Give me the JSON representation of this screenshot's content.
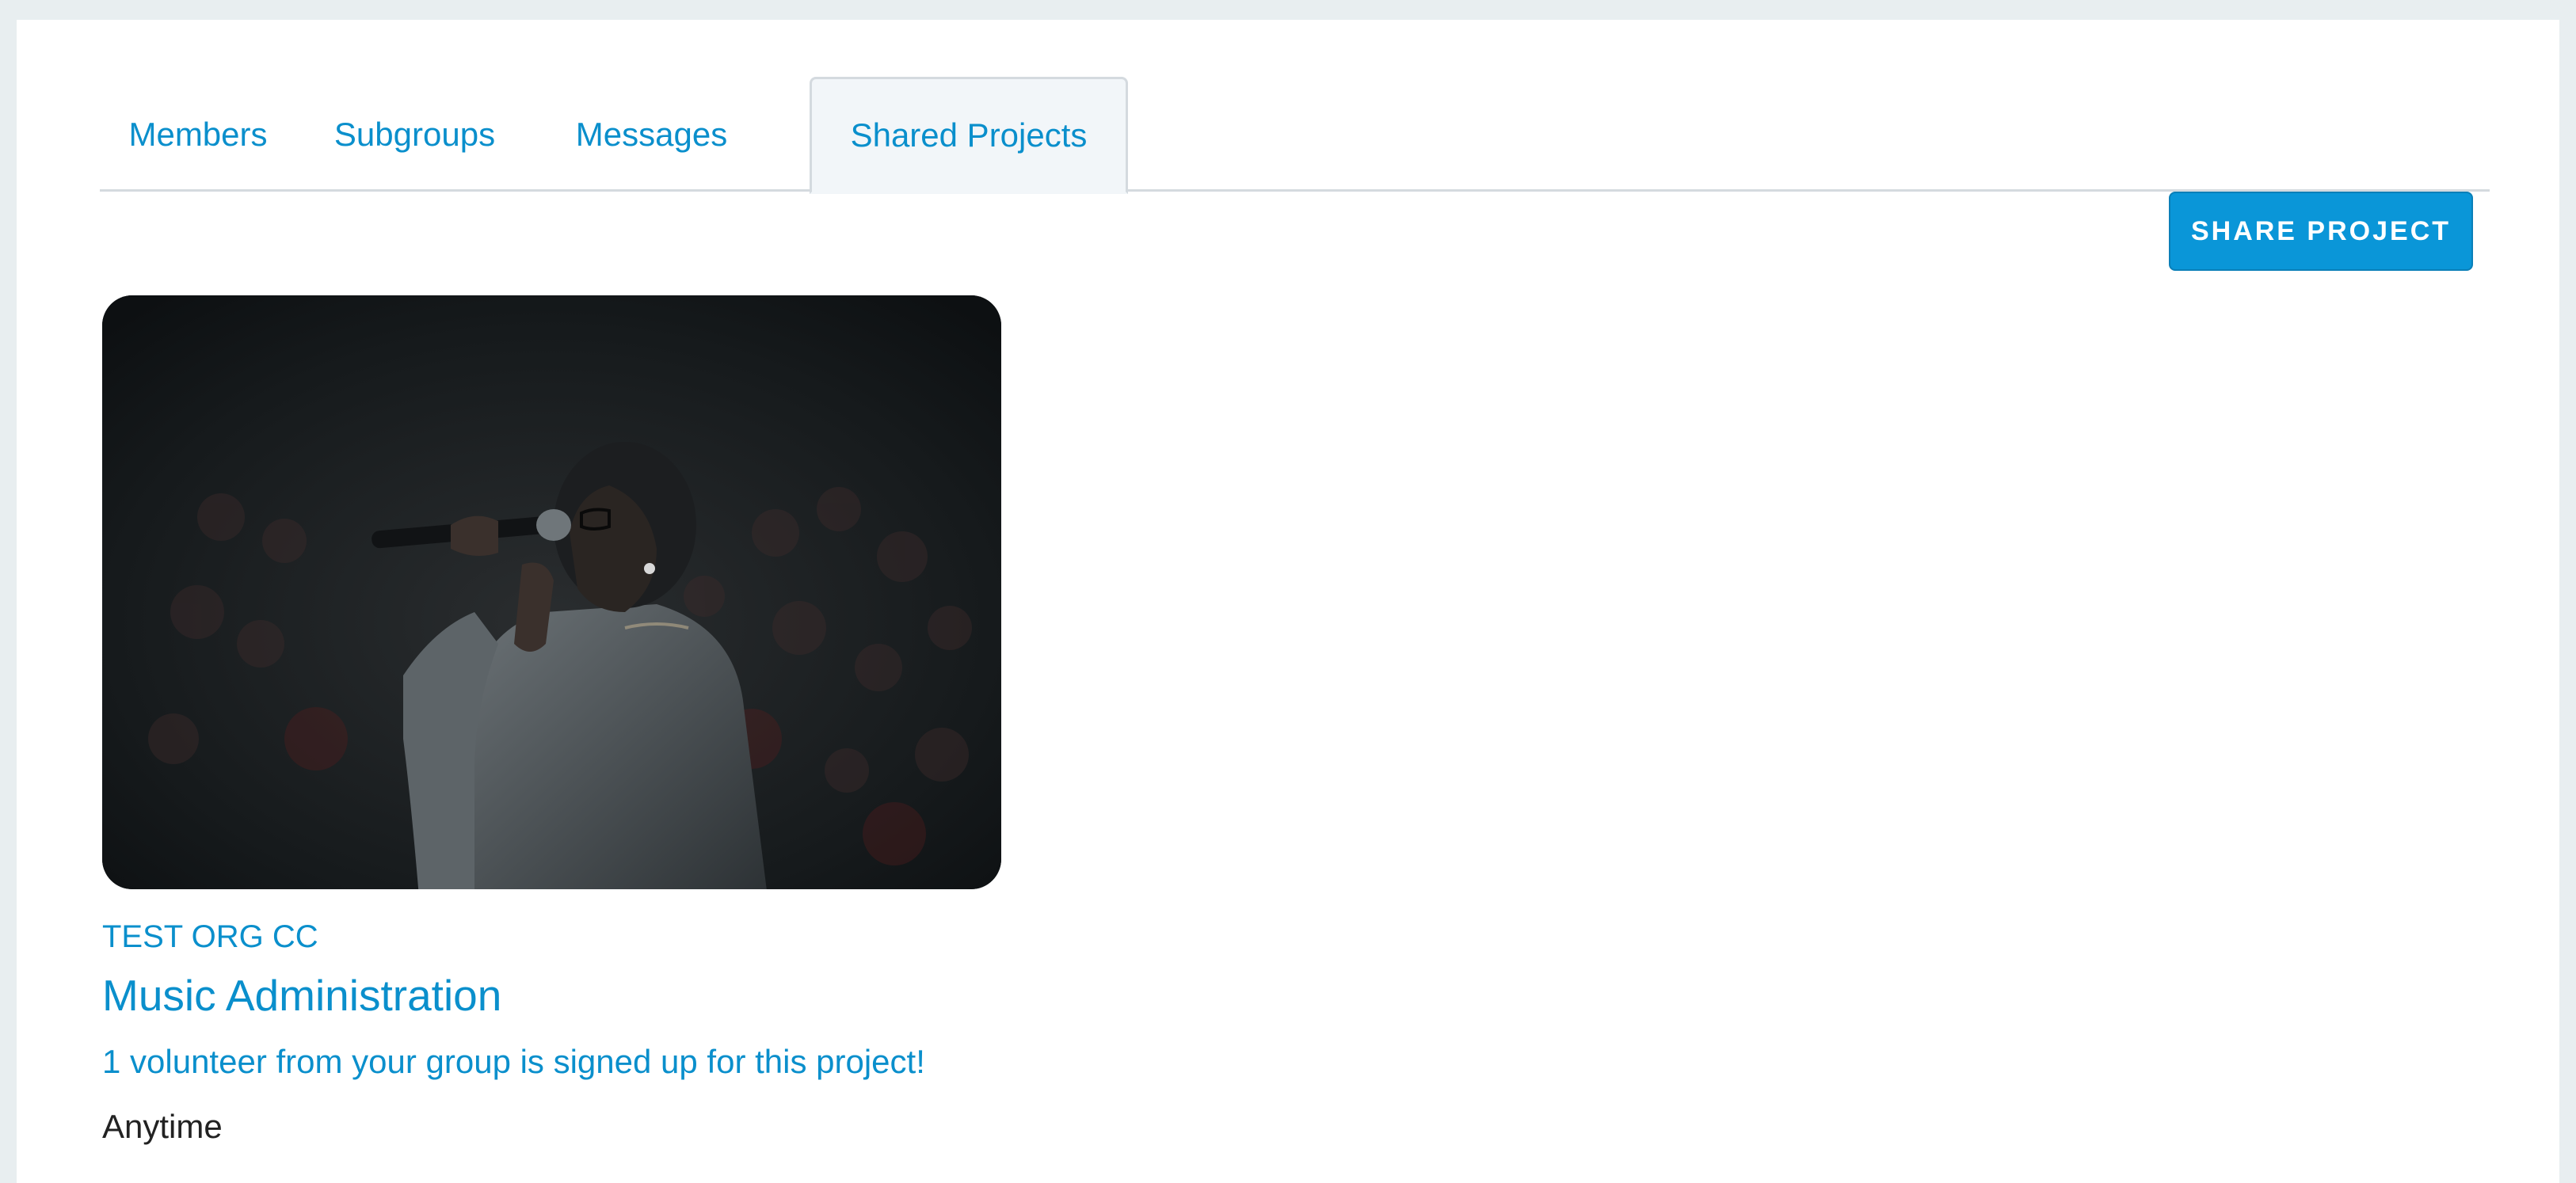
{
  "tabs": [
    {
      "label": "Members",
      "active": false
    },
    {
      "label": "Subgroups",
      "active": false
    },
    {
      "label": "Messages",
      "active": false
    },
    {
      "label": "Shared Projects",
      "active": true
    }
  ],
  "actions": {
    "share_project_label": "SHARE PROJECT"
  },
  "project_card": {
    "image_subject": "singer with microphone on dark stage",
    "organization": "TEST ORG CC",
    "title": "Music Administration",
    "volunteer_note": "1 volunteer from your group is signed up for this project!",
    "schedule": "Anytime"
  },
  "colors": {
    "accent": "#0a8fcc",
    "button": "#0a96d8",
    "page_background": "#e8eef0",
    "panel_background": "#ffffff",
    "active_tab_background": "#f2f6f9",
    "divider": "#d4dadf",
    "body_text": "#222222"
  }
}
